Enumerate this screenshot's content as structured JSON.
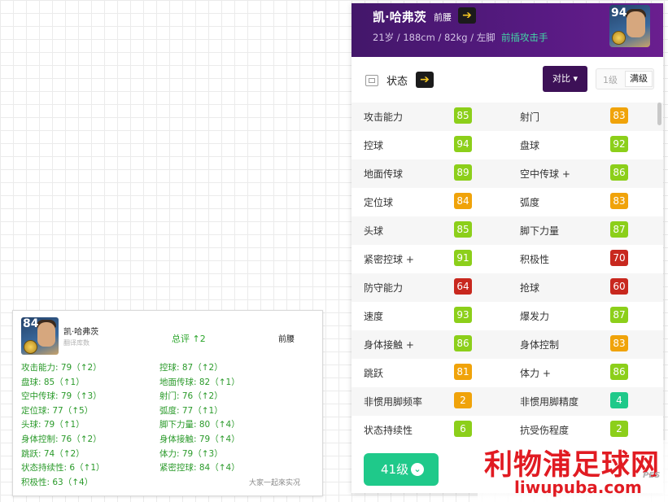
{
  "mini_card": {
    "overall": "84",
    "name": "凯·哈弗茨",
    "subtitle": "翻译库数",
    "total": "总评 ↑2",
    "position": "前腰",
    "stats_left": [
      "攻击能力: 79（↑2）",
      "盘球: 85（↑1）",
      "空中传球: 79（↑3）",
      "定位球: 77（↑5）",
      "头球: 79（↑1）",
      "身体控制: 76（↑2）",
      "跳跃: 74（↑2）",
      "状态持续性: 6（↑1）",
      "积极性: 63（↑4）"
    ],
    "stats_right": [
      "控球: 87（↑2）",
      "地面传球: 82（↑1）",
      "射门: 76（↑2）",
      "弧度: 77（↑1）",
      "脚下力量: 80（↑4）",
      "身体接触: 79（↑4）",
      "体力: 79（↑3）",
      "紧密控球: 84（↑4）"
    ],
    "watermark": "大家一起來实况"
  },
  "panel": {
    "header": {
      "name": "凯·哈弗茨",
      "position": "前腰",
      "info": "21岁 / 188cm / 82kg / 左脚",
      "role": "前插攻击手",
      "overall": "94",
      "arrow_icon": "➔"
    },
    "toolbar": {
      "status_label": "状态",
      "compare_label": "对比 ▾",
      "level_1": "1级",
      "level_max": "满级"
    },
    "colors": {
      "green": "#7ed321",
      "lightgreen": "#8ccf1a",
      "orange": "#f0a30a",
      "red": "#c8281e",
      "teal": "#1fc98a"
    },
    "stats": [
      {
        "l_label": "攻击能力",
        "l_value": "85",
        "l_color": "#8ccf1a",
        "r_label": "射门",
        "r_value": "83",
        "r_color": "#f0a30a"
      },
      {
        "l_label": "控球",
        "l_value": "94",
        "l_color": "#8ccf1a",
        "r_label": "盘球",
        "r_value": "92",
        "r_color": "#8ccf1a"
      },
      {
        "l_label": "地面传球",
        "l_value": "89",
        "l_color": "#8ccf1a",
        "r_label": "空中传球 +",
        "r_value": "86",
        "r_color": "#8ccf1a"
      },
      {
        "l_label": "定位球",
        "l_value": "84",
        "l_color": "#f0a30a",
        "r_label": "弧度",
        "r_value": "83",
        "r_color": "#f0a30a"
      },
      {
        "l_label": "头球",
        "l_value": "85",
        "l_color": "#8ccf1a",
        "r_label": "脚下力量",
        "r_value": "87",
        "r_color": "#8ccf1a"
      },
      {
        "l_label": "紧密控球 +",
        "l_value": "91",
        "l_color": "#8ccf1a",
        "r_label": "积极性",
        "r_value": "70",
        "r_color": "#c8281e"
      },
      {
        "l_label": "防守能力",
        "l_value": "64",
        "l_color": "#c8281e",
        "r_label": "抢球",
        "r_value": "60",
        "r_color": "#c8281e"
      },
      {
        "l_label": "速度",
        "l_value": "93",
        "l_color": "#8ccf1a",
        "r_label": "爆发力",
        "r_value": "87",
        "r_color": "#8ccf1a"
      },
      {
        "l_label": "身体接触 +",
        "l_value": "86",
        "l_color": "#8ccf1a",
        "r_label": "身体控制",
        "r_value": "83",
        "r_color": "#f0a30a"
      },
      {
        "l_label": "跳跃",
        "l_value": "81",
        "l_color": "#f0a30a",
        "r_label": "体力 +",
        "r_value": "86",
        "r_color": "#8ccf1a"
      },
      {
        "l_label": "非惯用脚频率",
        "l_value": "2",
        "l_color": "#f0a30a",
        "r_label": "非惯用脚精度",
        "r_value": "4",
        "r_color": "#1fc98a"
      },
      {
        "l_label": "状态持续性",
        "l_value": "6",
        "l_color": "#8ccf1a",
        "r_label": "抗受伤程度",
        "r_value": "2",
        "r_color": "#8ccf1a"
      }
    ],
    "level_button": "41级"
  },
  "brand": {
    "title": "利物浦足球网",
    "url": "liwupuba.com",
    "pes": "PES"
  }
}
